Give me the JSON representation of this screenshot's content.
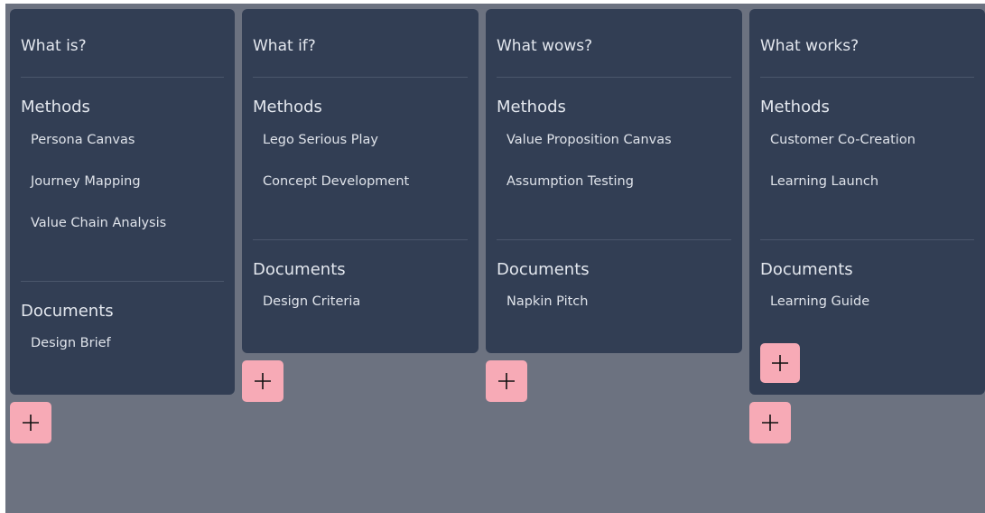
{
  "columns": [
    {
      "title": "What is?",
      "methods_label": "Methods",
      "methods": [
        "Persona Canvas",
        "Journey Mapping",
        "Value Chain Analysis"
      ],
      "documents_label": "Documents",
      "documents": [
        "Design Brief"
      ]
    },
    {
      "title": "What if?",
      "methods_label": "Methods",
      "methods": [
        "Lego Serious Play",
        "Concept Development"
      ],
      "documents_label": "Documents",
      "documents": [
        "Design Criteria"
      ]
    },
    {
      "title": "What wows?",
      "methods_label": "Methods",
      "methods": [
        "Value Proposition Canvas",
        "Assumption Testing"
      ],
      "documents_label": "Documents",
      "documents": [
        "Napkin Pitch"
      ]
    },
    {
      "title": "What works?",
      "methods_label": "Methods",
      "methods": [
        "Customer Co-Creation",
        "Learning Launch"
      ],
      "documents_label": "Documents",
      "documents": [
        "Learning Guide"
      ]
    }
  ],
  "add_button": {
    "icon": "plus-icon"
  },
  "colors": {
    "background": "#6c7280",
    "card": "#323e54",
    "add_button": "#f7aab6"
  }
}
